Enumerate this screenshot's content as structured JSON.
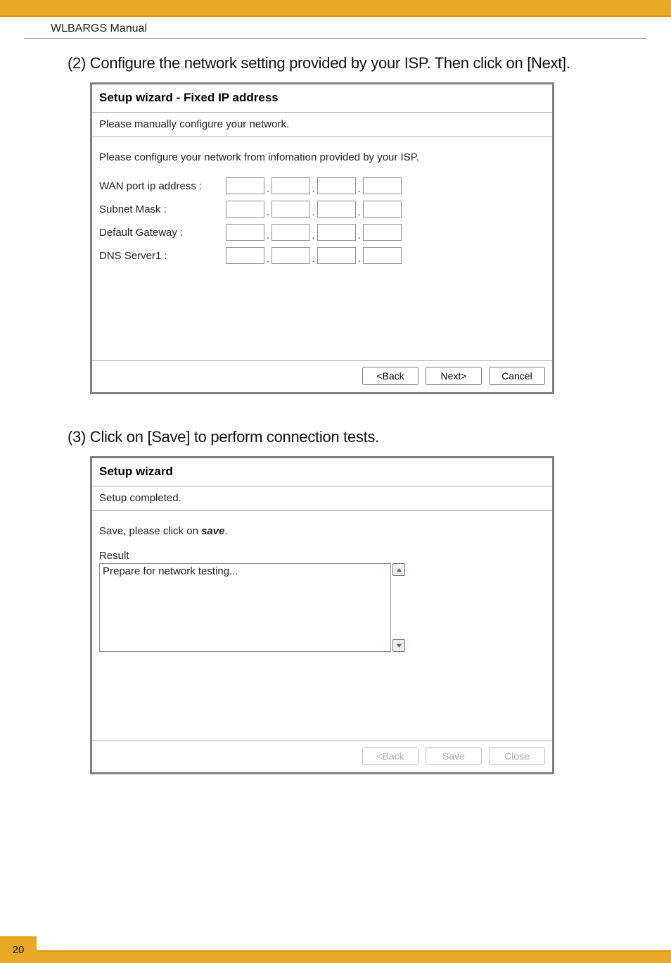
{
  "header": {
    "manual_label": "WLBARGS Manual"
  },
  "step2": {
    "instruction": "(2) Configure the network setting provided by your ISP. Then click on [Next].",
    "title": "Setup wizard - Fixed IP address",
    "subtitle": "Please manually configure your network.",
    "body_text": "Please configure your network from infomation provided by your ISP.",
    "fields": {
      "wan": "WAN port ip address :",
      "subnet": "Subnet Mask :",
      "gateway": "Default Gateway :",
      "dns1": "DNS Server1 :"
    },
    "buttons": {
      "back": "<Back",
      "next": "Next>",
      "cancel": "Cancel"
    }
  },
  "step3": {
    "instruction": "(3) Click on [Save] to perform connection tests.",
    "title": "Setup wizard",
    "subtitle": "Setup completed.",
    "save_prefix": "Save, please click on ",
    "save_bold": "save",
    "save_suffix": ".",
    "result_label": "Result",
    "result_text": "Prepare for network testing...",
    "buttons": {
      "back": "<Back",
      "save": "Save",
      "close": "Close"
    }
  },
  "page_number": "20"
}
